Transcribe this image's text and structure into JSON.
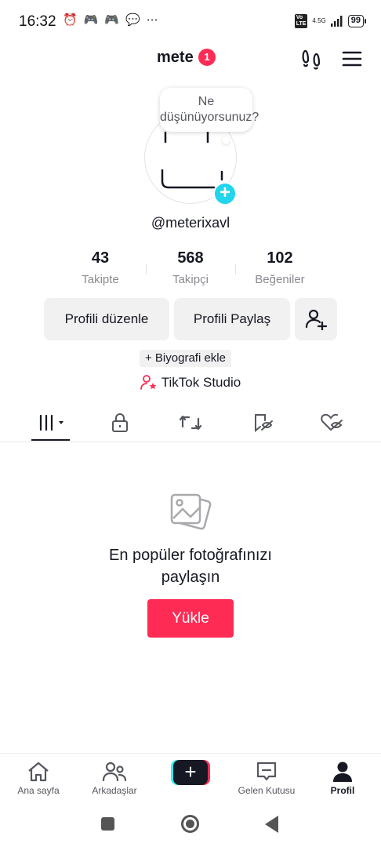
{
  "status_bar": {
    "time": "16:32",
    "network": "4.5G",
    "battery": "99"
  },
  "header": {
    "username": "mete",
    "notification_count": "1"
  },
  "profile": {
    "thought_bubble": "Ne düşünüyorsunuz?",
    "handle": "@meterixavl",
    "stats": [
      {
        "value": "43",
        "label": "Takipte"
      },
      {
        "value": "568",
        "label": "Takipçi"
      },
      {
        "value": "102",
        "label": "Beğeniler"
      }
    ],
    "edit_profile_label": "Profili düzenle",
    "share_profile_label": "Profili Paylaş",
    "add_bio_label": "+ Biyografi ekle",
    "studio_label": "TikTok Studio"
  },
  "empty_state": {
    "title_line1": "En popüler fotoğrafınızı",
    "title_line2": "paylaşın",
    "upload_label": "Yükle"
  },
  "bottom_nav": {
    "home": "Ana sayfa",
    "friends": "Arkadaşlar",
    "inbox": "Gelen Kutusu",
    "profile": "Profil"
  },
  "colors": {
    "accent_red": "#fe2c55",
    "accent_cyan": "#20d5ec",
    "text_primary": "#161823",
    "text_secondary": "#8a8b91"
  }
}
